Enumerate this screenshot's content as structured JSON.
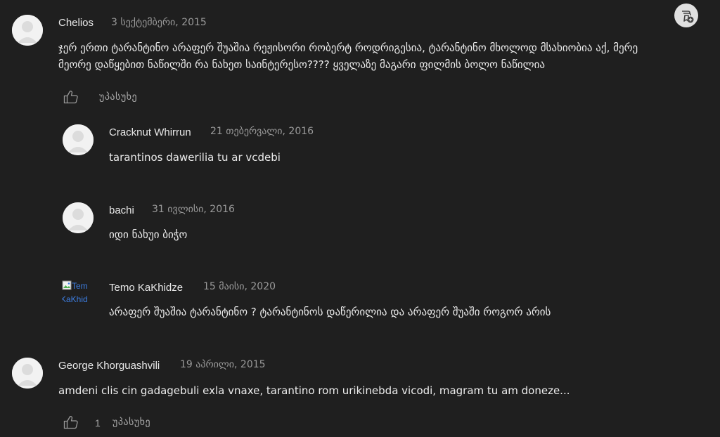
{
  "colors": {
    "background": "#1f1f1f",
    "author": "#e8e8e8",
    "date": "#9a9a9a",
    "body_text": "#ececec",
    "action": "#a9a9a9",
    "link_blue": "#3d7de0"
  },
  "toolbar": {
    "corner_button_icon": "add-to-collection-icon"
  },
  "comments": [
    {
      "author": "Chelios",
      "date": "3 სექტემბერი, 2015",
      "text_line1": "ჯერ ერთი ტარანტინო არაფერ შუაშია რეჟისორი რობერტ როდრიგესია, ტარანტინო მხოლოდ მსახიობია აქ, მერე",
      "text_line2": "მეორე დაწყებით ნაწილში რა ნახეთ საინტერესო???? ყველაზე მაგარი ფილმის ბოლო ნაწილია",
      "reply_label": "უპასუხე",
      "replies": [
        {
          "author": "Cracknut Whirrun",
          "date": "21 თებერვალი, 2016",
          "text": "tarantinos dawerilia tu ar vcdebi"
        },
        {
          "author": "bachi",
          "date": "31 ივლისი, 2016",
          "text": "იდი ნახუი ბიჭო"
        },
        {
          "author": "Temo KaKhidze",
          "date": "15 მაისი, 2020",
          "avatar_alt_line1": "Tem",
          "avatar_alt_line2": "KaKhid",
          "text": "არაფერ შუაშია ტარანტინო ? ტარანტინოს დაწერილია და არაფერ შუაში როგორ არის"
        }
      ]
    },
    {
      "author": "George Khorguashvili",
      "date": "19 აპრილი, 2015",
      "text": "amdeni clis cin gadagebuli exla vnaxe, tarantino rom urikinebda vicodi, magram tu am doneze...",
      "like_count": "1",
      "reply_label": "უპასუხე"
    }
  ]
}
